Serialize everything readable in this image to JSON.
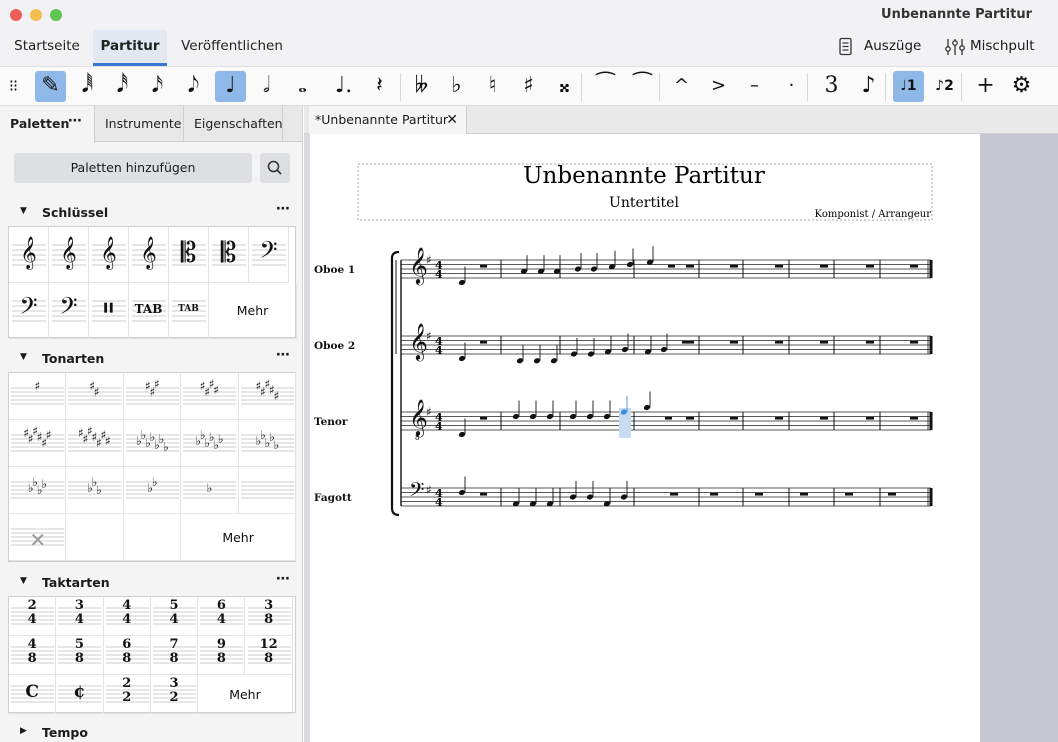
{
  "window": {
    "title": "Unbenannte Partitur"
  },
  "top_tabs": [
    "Startseite",
    "Partitur",
    "Veröffentlichen"
  ],
  "right_actions": {
    "parts": "Auszüge",
    "mixer": "Mischpult"
  },
  "toolbar": {
    "glyphs": [
      "✎",
      "𝅘𝅥𝅱",
      "𝅘𝅥𝅰",
      "𝅘𝅥𝅯",
      "𝅘𝅥𝅮",
      "♩",
      "𝅗𝅥",
      "𝅝",
      "♩.",
      "𝄽",
      "𝄫",
      "♭",
      "♮",
      "♯",
      "𝄪",
      "⁀",
      "⁀",
      "^",
      ">",
      "–",
      "·",
      "3",
      "♪",
      "1",
      "2",
      "+",
      "⚙"
    ],
    "icons": [
      "drag-handle-icon",
      "note-input-pencil-icon",
      "64th-note-icon",
      "32nd-note-icon",
      "16th-note-icon",
      "eighth-note-icon",
      "quarter-note-icon",
      "half-note-icon",
      "whole-note-icon",
      "augmentation-dot-icon",
      "rest-icon",
      "double-flat-icon",
      "flat-icon",
      "natural-icon",
      "sharp-icon",
      "double-sharp-icon",
      "tie-icon",
      "slur-icon",
      "marcato-icon",
      "accent-icon",
      "tenuto-icon",
      "staccato-icon",
      "tuplet-icon",
      "flip-direction-icon",
      "voice-1-icon",
      "voice-2-icon",
      "add-icon",
      "settings-icon"
    ]
  },
  "sidebar": {
    "tabs": [
      "Paletten",
      "Instrumente",
      "Eigenschaften"
    ],
    "menu_dots": "⋯",
    "add_palettes_button": "Paletten hinzufügen",
    "sections": {
      "clefs": {
        "title": "Schlüssel",
        "more": "Mehr"
      },
      "keys": {
        "title": "Tonarten",
        "more": "Mehr"
      },
      "timesigs": {
        "title": "Taktarten",
        "items": [
          "2/4",
          "3/4",
          "4/4",
          "5/4",
          "6/4",
          "3/8",
          "4/8",
          "5/8",
          "6/8",
          "7/8",
          "9/8",
          "12/8",
          "C",
          "¢",
          "2/2",
          "3/2"
        ],
        "more": "Mehr"
      },
      "tempo": {
        "title": "Tempo"
      }
    }
  },
  "document": {
    "tab_title": "*Unbenannte Partitur",
    "title": "Unbenannte Partitur",
    "subtitle": "Untertitel",
    "composer": "Komponist / Arrangeur",
    "instruments": [
      "Oboe 1",
      "Oboe 2",
      "Tenor",
      "Fagott"
    ]
  },
  "colors": {
    "accent": "#3877d1",
    "active_tool": "#8eb8e8",
    "selection": "#3f8ed8"
  }
}
